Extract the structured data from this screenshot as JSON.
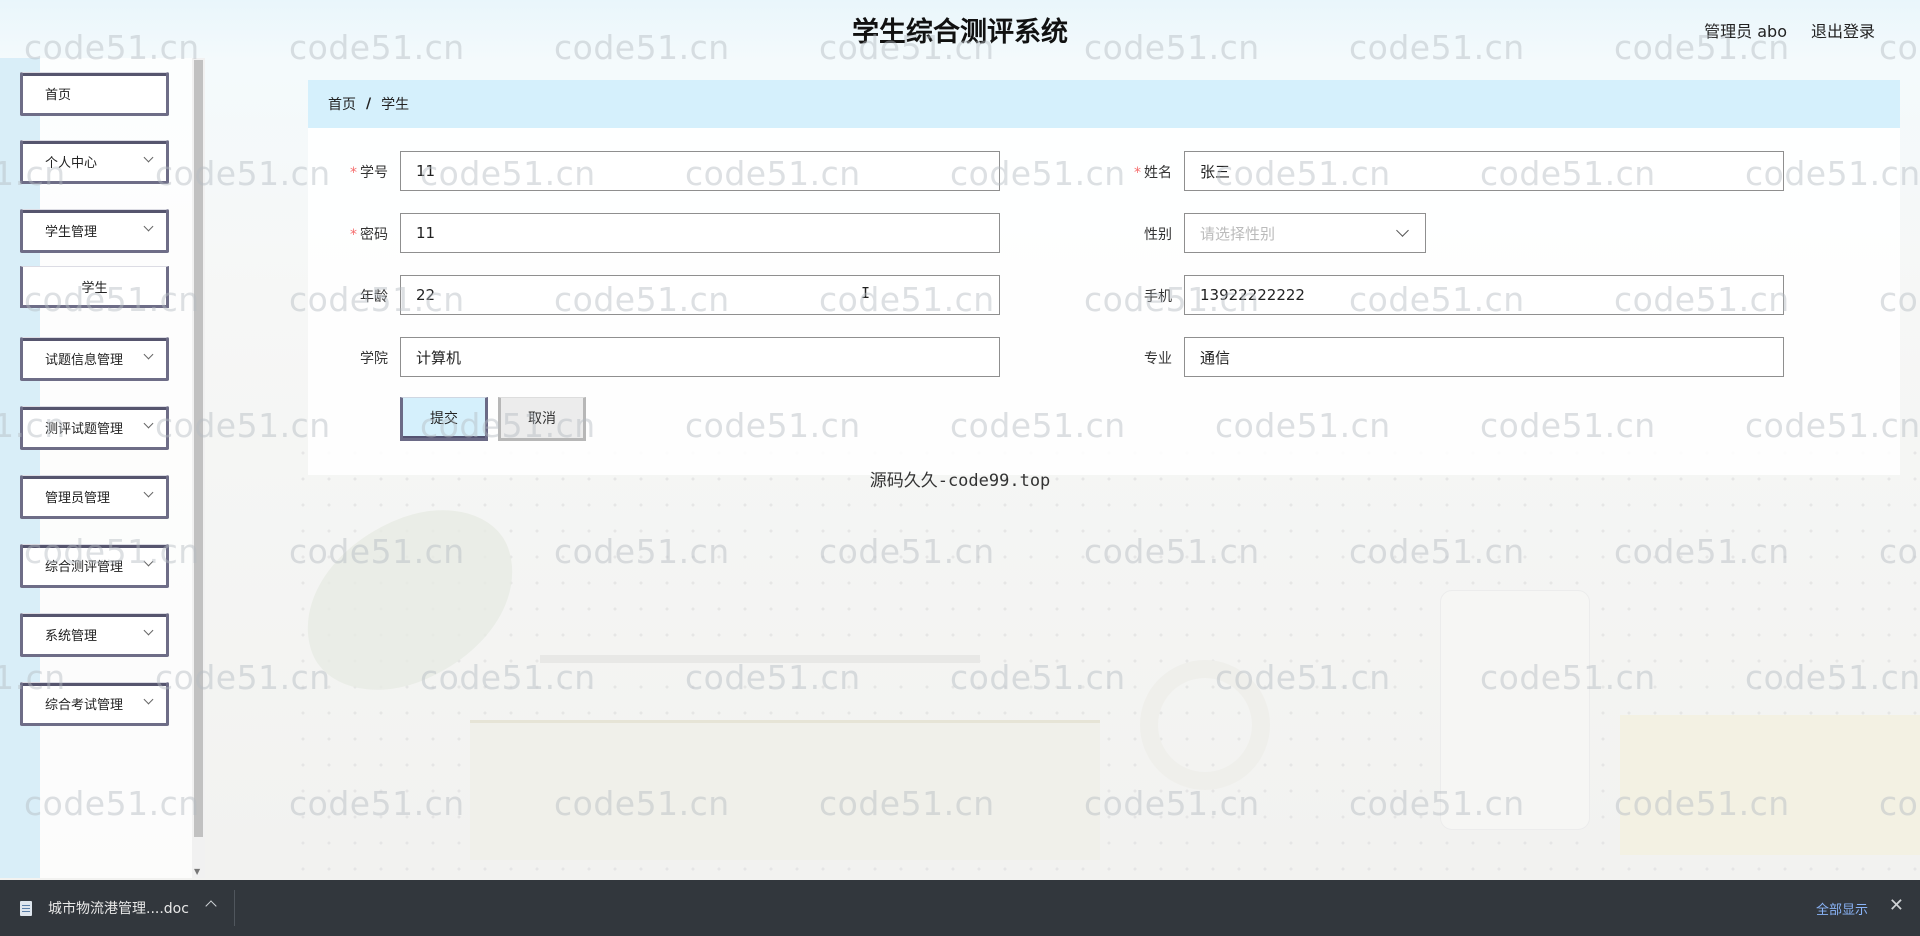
{
  "header": {
    "title": "学生综合测评系统",
    "user_label": "管理员 abo",
    "logout_label": "退出登录"
  },
  "sidebar": {
    "items": [
      {
        "label": "首页",
        "has_arrow": false
      },
      {
        "label": "个人中心",
        "has_arrow": true
      },
      {
        "label": "学生管理",
        "has_arrow": true
      },
      {
        "label": "学生",
        "sub": true
      },
      {
        "label": "试题信息管理",
        "has_arrow": true
      },
      {
        "label": "测评试题管理",
        "has_arrow": true
      },
      {
        "label": "管理员管理",
        "has_arrow": true
      },
      {
        "label": "综合测评管理",
        "has_arrow": true
      },
      {
        "label": "系统管理",
        "has_arrow": true
      },
      {
        "label": "综合考试管理",
        "has_arrow": true
      }
    ]
  },
  "breadcrumb": {
    "home": "首页",
    "separator": "/",
    "current": "学生"
  },
  "form": {
    "student_id": {
      "label": "学号",
      "required": true,
      "value": "11"
    },
    "name": {
      "label": "姓名",
      "required": true,
      "value": "张三"
    },
    "password": {
      "label": "密码",
      "required": true,
      "value": "11"
    },
    "gender": {
      "label": "性别",
      "required": false,
      "placeholder": "请选择性别"
    },
    "age": {
      "label": "年龄",
      "required": false,
      "value": "22"
    },
    "phone": {
      "label": "手机",
      "required": false,
      "value": "13922222222"
    },
    "college": {
      "label": "学院",
      "required": false,
      "value": "计算机"
    },
    "major": {
      "label": "专业",
      "required": false,
      "value": "通信"
    },
    "submit_label": "提交",
    "cancel_label": "取消",
    "required_mark": "*"
  },
  "footer_text": "源码久久-code99.top",
  "watermark_text": "code51.cn",
  "download_bar": {
    "file_name": "城市物流港管理....doc",
    "show_all_label": "全部显示",
    "close_symbol": "✕"
  },
  "colors": {
    "accent_light_blue": "#d5f0fc",
    "menu_border": "#6e6d87",
    "required_red": "#f56c6c",
    "download_bar": "#32373d",
    "link_blue": "#8ab4f8"
  }
}
